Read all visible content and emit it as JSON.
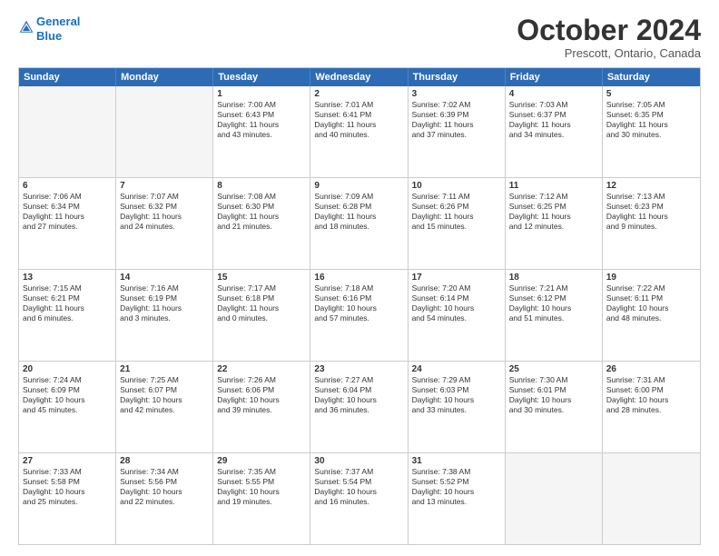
{
  "header": {
    "logo_line1": "General",
    "logo_line2": "Blue",
    "month": "October 2024",
    "location": "Prescott, Ontario, Canada"
  },
  "weekdays": [
    "Sunday",
    "Monday",
    "Tuesday",
    "Wednesday",
    "Thursday",
    "Friday",
    "Saturday"
  ],
  "rows": [
    [
      {
        "day": "",
        "empty": true
      },
      {
        "day": "",
        "empty": true
      },
      {
        "day": "1",
        "line1": "Sunrise: 7:00 AM",
        "line2": "Sunset: 6:43 PM",
        "line3": "Daylight: 11 hours",
        "line4": "and 43 minutes."
      },
      {
        "day": "2",
        "line1": "Sunrise: 7:01 AM",
        "line2": "Sunset: 6:41 PM",
        "line3": "Daylight: 11 hours",
        "line4": "and 40 minutes."
      },
      {
        "day": "3",
        "line1": "Sunrise: 7:02 AM",
        "line2": "Sunset: 6:39 PM",
        "line3": "Daylight: 11 hours",
        "line4": "and 37 minutes."
      },
      {
        "day": "4",
        "line1": "Sunrise: 7:03 AM",
        "line2": "Sunset: 6:37 PM",
        "line3": "Daylight: 11 hours",
        "line4": "and 34 minutes."
      },
      {
        "day": "5",
        "line1": "Sunrise: 7:05 AM",
        "line2": "Sunset: 6:35 PM",
        "line3": "Daylight: 11 hours",
        "line4": "and 30 minutes."
      }
    ],
    [
      {
        "day": "6",
        "line1": "Sunrise: 7:06 AM",
        "line2": "Sunset: 6:34 PM",
        "line3": "Daylight: 11 hours",
        "line4": "and 27 minutes."
      },
      {
        "day": "7",
        "line1": "Sunrise: 7:07 AM",
        "line2": "Sunset: 6:32 PM",
        "line3": "Daylight: 11 hours",
        "line4": "and 24 minutes."
      },
      {
        "day": "8",
        "line1": "Sunrise: 7:08 AM",
        "line2": "Sunset: 6:30 PM",
        "line3": "Daylight: 11 hours",
        "line4": "and 21 minutes."
      },
      {
        "day": "9",
        "line1": "Sunrise: 7:09 AM",
        "line2": "Sunset: 6:28 PM",
        "line3": "Daylight: 11 hours",
        "line4": "and 18 minutes."
      },
      {
        "day": "10",
        "line1": "Sunrise: 7:11 AM",
        "line2": "Sunset: 6:26 PM",
        "line3": "Daylight: 11 hours",
        "line4": "and 15 minutes."
      },
      {
        "day": "11",
        "line1": "Sunrise: 7:12 AM",
        "line2": "Sunset: 6:25 PM",
        "line3": "Daylight: 11 hours",
        "line4": "and 12 minutes."
      },
      {
        "day": "12",
        "line1": "Sunrise: 7:13 AM",
        "line2": "Sunset: 6:23 PM",
        "line3": "Daylight: 11 hours",
        "line4": "and 9 minutes."
      }
    ],
    [
      {
        "day": "13",
        "line1": "Sunrise: 7:15 AM",
        "line2": "Sunset: 6:21 PM",
        "line3": "Daylight: 11 hours",
        "line4": "and 6 minutes."
      },
      {
        "day": "14",
        "line1": "Sunrise: 7:16 AM",
        "line2": "Sunset: 6:19 PM",
        "line3": "Daylight: 11 hours",
        "line4": "and 3 minutes."
      },
      {
        "day": "15",
        "line1": "Sunrise: 7:17 AM",
        "line2": "Sunset: 6:18 PM",
        "line3": "Daylight: 11 hours",
        "line4": "and 0 minutes."
      },
      {
        "day": "16",
        "line1": "Sunrise: 7:18 AM",
        "line2": "Sunset: 6:16 PM",
        "line3": "Daylight: 10 hours",
        "line4": "and 57 minutes."
      },
      {
        "day": "17",
        "line1": "Sunrise: 7:20 AM",
        "line2": "Sunset: 6:14 PM",
        "line3": "Daylight: 10 hours",
        "line4": "and 54 minutes."
      },
      {
        "day": "18",
        "line1": "Sunrise: 7:21 AM",
        "line2": "Sunset: 6:12 PM",
        "line3": "Daylight: 10 hours",
        "line4": "and 51 minutes."
      },
      {
        "day": "19",
        "line1": "Sunrise: 7:22 AM",
        "line2": "Sunset: 6:11 PM",
        "line3": "Daylight: 10 hours",
        "line4": "and 48 minutes."
      }
    ],
    [
      {
        "day": "20",
        "line1": "Sunrise: 7:24 AM",
        "line2": "Sunset: 6:09 PM",
        "line3": "Daylight: 10 hours",
        "line4": "and 45 minutes."
      },
      {
        "day": "21",
        "line1": "Sunrise: 7:25 AM",
        "line2": "Sunset: 6:07 PM",
        "line3": "Daylight: 10 hours",
        "line4": "and 42 minutes."
      },
      {
        "day": "22",
        "line1": "Sunrise: 7:26 AM",
        "line2": "Sunset: 6:06 PM",
        "line3": "Daylight: 10 hours",
        "line4": "and 39 minutes."
      },
      {
        "day": "23",
        "line1": "Sunrise: 7:27 AM",
        "line2": "Sunset: 6:04 PM",
        "line3": "Daylight: 10 hours",
        "line4": "and 36 minutes."
      },
      {
        "day": "24",
        "line1": "Sunrise: 7:29 AM",
        "line2": "Sunset: 6:03 PM",
        "line3": "Daylight: 10 hours",
        "line4": "and 33 minutes."
      },
      {
        "day": "25",
        "line1": "Sunrise: 7:30 AM",
        "line2": "Sunset: 6:01 PM",
        "line3": "Daylight: 10 hours",
        "line4": "and 30 minutes."
      },
      {
        "day": "26",
        "line1": "Sunrise: 7:31 AM",
        "line2": "Sunset: 6:00 PM",
        "line3": "Daylight: 10 hours",
        "line4": "and 28 minutes."
      }
    ],
    [
      {
        "day": "27",
        "line1": "Sunrise: 7:33 AM",
        "line2": "Sunset: 5:58 PM",
        "line3": "Daylight: 10 hours",
        "line4": "and 25 minutes."
      },
      {
        "day": "28",
        "line1": "Sunrise: 7:34 AM",
        "line2": "Sunset: 5:56 PM",
        "line3": "Daylight: 10 hours",
        "line4": "and 22 minutes."
      },
      {
        "day": "29",
        "line1": "Sunrise: 7:35 AM",
        "line2": "Sunset: 5:55 PM",
        "line3": "Daylight: 10 hours",
        "line4": "and 19 minutes."
      },
      {
        "day": "30",
        "line1": "Sunrise: 7:37 AM",
        "line2": "Sunset: 5:54 PM",
        "line3": "Daylight: 10 hours",
        "line4": "and 16 minutes."
      },
      {
        "day": "31",
        "line1": "Sunrise: 7:38 AM",
        "line2": "Sunset: 5:52 PM",
        "line3": "Daylight: 10 hours",
        "line4": "and 13 minutes."
      },
      {
        "day": "",
        "empty": true
      },
      {
        "day": "",
        "empty": true
      }
    ]
  ]
}
